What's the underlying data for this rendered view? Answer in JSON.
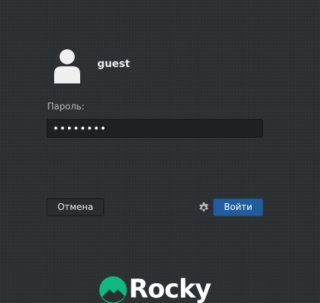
{
  "user": {
    "name": "guest",
    "avatar_icon": "user-avatar-icon"
  },
  "password": {
    "label": "Пароль:",
    "value": "••••••••"
  },
  "buttons": {
    "cancel_label": "Отмена",
    "login_label": "Войти",
    "settings_icon": "gear-icon"
  },
  "branding": {
    "logo_text": "Rocky",
    "logo_icon": "rocky-logo-icon"
  },
  "colors": {
    "background": "#2b2f31",
    "accent": "#215d9c",
    "logo_green": "#10b981"
  }
}
